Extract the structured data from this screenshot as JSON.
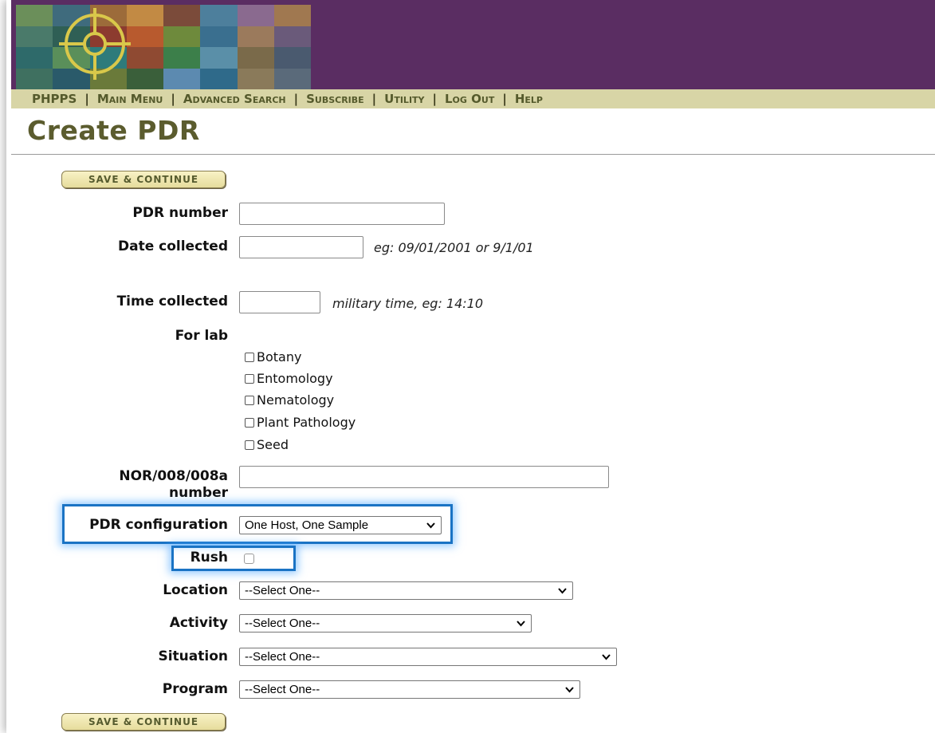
{
  "nav": {
    "items": [
      "PHPPS",
      "Main Menu",
      "Advanced Search",
      "Subscribe",
      "Utility",
      "Log Out",
      "Help"
    ]
  },
  "page": {
    "title": "Create PDR"
  },
  "buttons": {
    "save_continue": "SAVE & CONTINUE"
  },
  "form": {
    "pdr_number": {
      "label": "PDR number",
      "value": ""
    },
    "date_collected": {
      "label": "Date collected",
      "value": "",
      "hint": "eg: 09/01/2001 or 9/1/01"
    },
    "time_collected": {
      "label": "Time collected",
      "value": "",
      "hint": "military time, eg: 14:10"
    },
    "for_lab": {
      "label": "For lab",
      "options": [
        "Botany",
        "Entomology",
        "Nematology",
        "Plant Pathology",
        "Seed"
      ]
    },
    "nor_number": {
      "label_line1": "NOR/008/008a",
      "label_line2": "number",
      "value": ""
    },
    "pdr_configuration": {
      "label": "PDR configuration",
      "selected": "One Host, One Sample"
    },
    "rush": {
      "label": "Rush",
      "checked": false
    },
    "location": {
      "label": "Location",
      "selected": "--Select One--"
    },
    "activity": {
      "label": "Activity",
      "selected": "--Select One--"
    },
    "situation": {
      "label": "Situation",
      "selected": "--Select One--"
    },
    "program": {
      "label": "Program",
      "selected": "--Select One--"
    }
  },
  "colors": {
    "banner": "#5a2d62",
    "navbar": "#d8d5a6",
    "nav_text": "#555a2c",
    "title": "#5b5c2e",
    "highlight": "#1a73c4"
  }
}
